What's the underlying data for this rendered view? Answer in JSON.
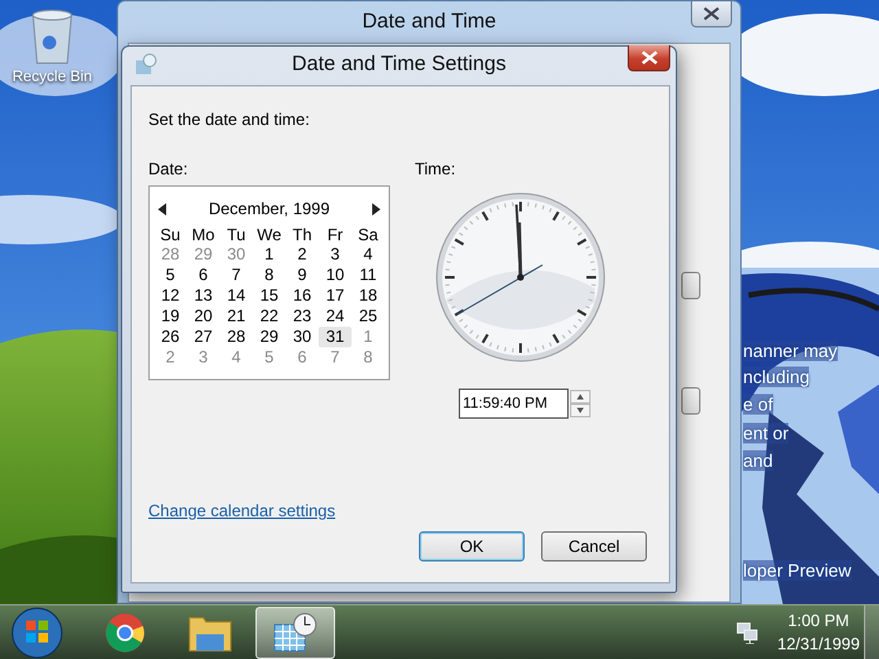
{
  "desktop": {
    "icons": [
      {
        "label": "Recycle Bin"
      }
    ],
    "wallpaper_text": [
      {
        "text": "nanner may"
      },
      {
        "text": "ncluding"
      },
      {
        "text": "e of"
      },
      {
        "text": "ent or"
      },
      {
        "text": "and"
      },
      {
        "text": "loper Preview"
      }
    ]
  },
  "background_window": {
    "title": "Date and Time"
  },
  "dialog": {
    "title": "Date and Time Settings",
    "prompt": "Set the date and time:",
    "date_label": "Date:",
    "time_label": "Time:",
    "calendar": {
      "month": "December, 1999",
      "weekdays": [
        "Su",
        "Mo",
        "Tu",
        "We",
        "Th",
        "Fr",
        "Sa"
      ],
      "days": [
        {
          "label": "28",
          "other_month": true,
          "selected": false
        },
        {
          "label": "29",
          "other_month": true,
          "selected": false
        },
        {
          "label": "30",
          "other_month": true,
          "selected": false
        },
        {
          "label": "1",
          "other_month": false,
          "selected": false
        },
        {
          "label": "2",
          "other_month": false,
          "selected": false
        },
        {
          "label": "3",
          "other_month": false,
          "selected": false
        },
        {
          "label": "4",
          "other_month": false,
          "selected": false
        },
        {
          "label": "5",
          "other_month": false,
          "selected": false
        },
        {
          "label": "6",
          "other_month": false,
          "selected": false
        },
        {
          "label": "7",
          "other_month": false,
          "selected": false
        },
        {
          "label": "8",
          "other_month": false,
          "selected": false
        },
        {
          "label": "9",
          "other_month": false,
          "selected": false
        },
        {
          "label": "10",
          "other_month": false,
          "selected": false
        },
        {
          "label": "11",
          "other_month": false,
          "selected": false
        },
        {
          "label": "12",
          "other_month": false,
          "selected": false
        },
        {
          "label": "13",
          "other_month": false,
          "selected": false
        },
        {
          "label": "14",
          "other_month": false,
          "selected": false
        },
        {
          "label": "15",
          "other_month": false,
          "selected": false
        },
        {
          "label": "16",
          "other_month": false,
          "selected": false
        },
        {
          "label": "17",
          "other_month": false,
          "selected": false
        },
        {
          "label": "18",
          "other_month": false,
          "selected": false
        },
        {
          "label": "19",
          "other_month": false,
          "selected": false
        },
        {
          "label": "20",
          "other_month": false,
          "selected": false
        },
        {
          "label": "21",
          "other_month": false,
          "selected": false
        },
        {
          "label": "22",
          "other_month": false,
          "selected": false
        },
        {
          "label": "23",
          "other_month": false,
          "selected": false
        },
        {
          "label": "24",
          "other_month": false,
          "selected": false
        },
        {
          "label": "25",
          "other_month": false,
          "selected": false
        },
        {
          "label": "26",
          "other_month": false,
          "selected": false
        },
        {
          "label": "27",
          "other_month": false,
          "selected": false
        },
        {
          "label": "28",
          "other_month": false,
          "selected": false
        },
        {
          "label": "29",
          "other_month": false,
          "selected": false
        },
        {
          "label": "30",
          "other_month": false,
          "selected": false
        },
        {
          "label": "31",
          "other_month": false,
          "selected": true
        },
        {
          "label": "1",
          "other_month": true,
          "selected": false
        },
        {
          "label": "2",
          "other_month": true,
          "selected": false
        },
        {
          "label": "3",
          "other_month": true,
          "selected": false
        },
        {
          "label": "4",
          "other_month": true,
          "selected": false
        },
        {
          "label": "5",
          "other_month": true,
          "selected": false
        },
        {
          "label": "6",
          "other_month": true,
          "selected": false
        },
        {
          "label": "7",
          "other_month": true,
          "selected": false
        },
        {
          "label": "8",
          "other_month": true,
          "selected": false
        }
      ]
    },
    "time_value": "11:59:40 PM",
    "link": "Change calendar settings",
    "buttons": [
      {
        "label": "OK",
        "default": true
      },
      {
        "label": "Cancel",
        "default": false
      }
    ]
  },
  "taskbar": {
    "apps": [
      {
        "kind": "browser",
        "active": false
      },
      {
        "kind": "folder",
        "active": false
      },
      {
        "kind": "datetime",
        "active": true
      }
    ],
    "clock": {
      "time": "1:00 PM",
      "date": "12/31/1999"
    }
  }
}
